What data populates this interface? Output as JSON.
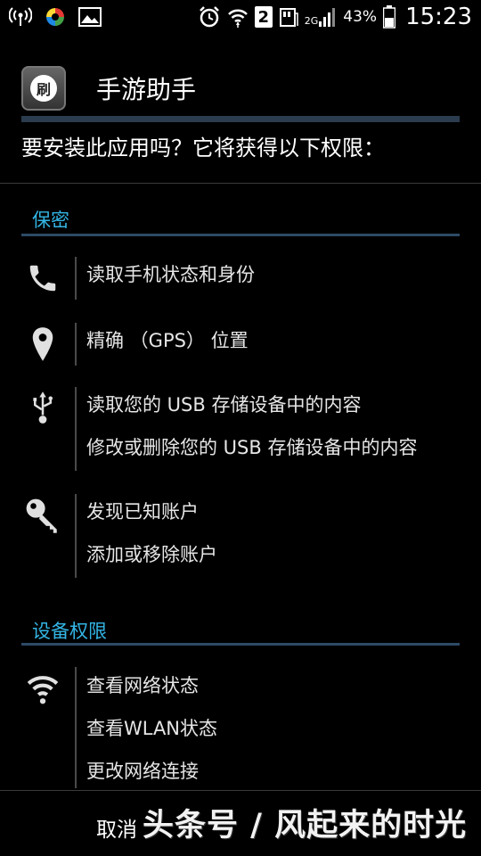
{
  "status_bar": {
    "battery_percent": "43%",
    "network": "2G",
    "sim_slot": "2",
    "time": "15:23",
    "icons_left": [
      "hotspot-icon",
      "app-notification-icon",
      "gallery-icon"
    ],
    "icons_right": [
      "alarm-icon",
      "wifi-icon",
      "sim2-icon",
      "data-icon",
      "signal-icon",
      "battery-icon"
    ]
  },
  "app": {
    "name": "手游助手",
    "icon_glyph": "刷"
  },
  "install": {
    "question": "要安装此应用吗？它将获得以下权限："
  },
  "sections": [
    {
      "title": "保密",
      "groups": [
        {
          "icon": "phone-icon",
          "items": [
            "读取手机状态和身份"
          ]
        },
        {
          "icon": "location-pin-icon",
          "items": [
            "精确 （GPS） 位置"
          ]
        },
        {
          "icon": "usb-icon",
          "items": [
            "读取您的 USB 存储设备中的内容",
            "修改或删除您的 USB 存储设备中的内容"
          ]
        },
        {
          "icon": "key-icon",
          "items": [
            "发现已知账户",
            "添加或移除账户"
          ]
        }
      ]
    },
    {
      "title": "设备权限",
      "groups": [
        {
          "icon": "wifi-icon",
          "items": [
            "查看网络状态",
            "查看WLAN状态",
            "更改网络连接"
          ]
        }
      ]
    }
  ],
  "buttons": {
    "cancel": "取消"
  },
  "watermark": "头条号 / 风起来的时光",
  "colors": {
    "accent": "#33b5e5",
    "background": "#000000",
    "header_bar": "#2a3c4d",
    "section_line": "#2d4a66"
  }
}
